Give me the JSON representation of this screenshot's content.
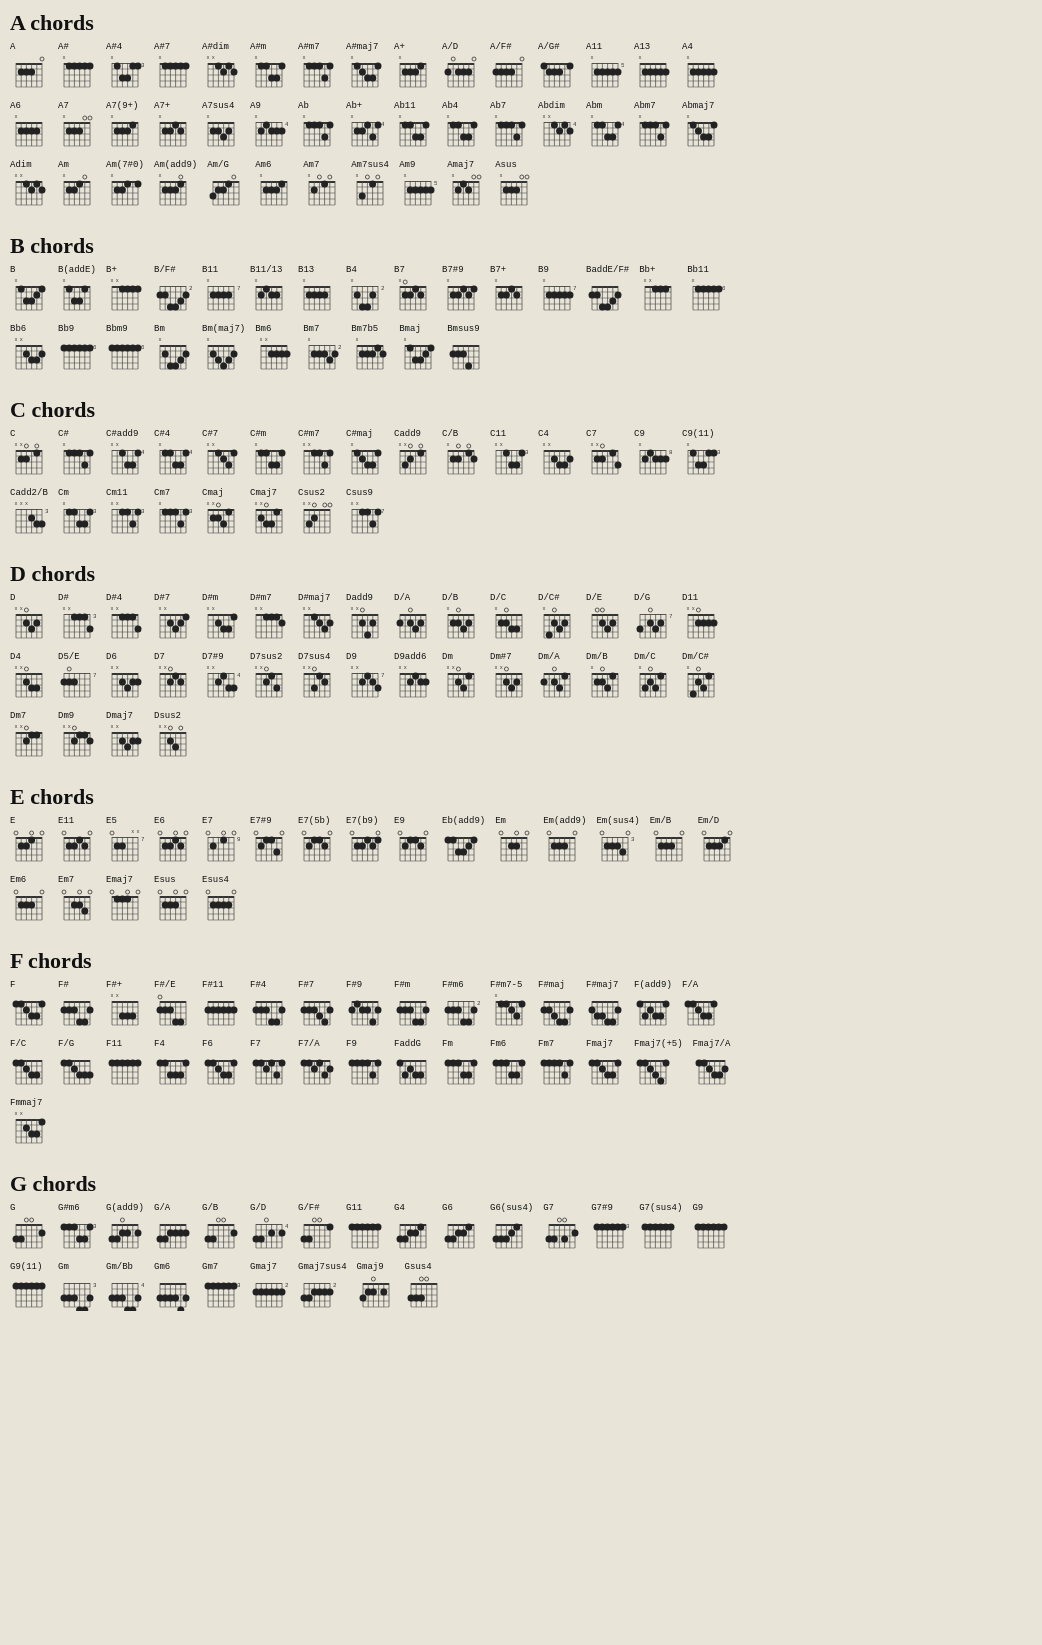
{
  "sections": [
    {
      "id": "A",
      "title": "A chords"
    },
    {
      "id": "B",
      "title": "B chords"
    },
    {
      "id": "C",
      "title": "C chords"
    },
    {
      "id": "D",
      "title": "D chords"
    },
    {
      "id": "E",
      "title": "E chords"
    },
    {
      "id": "F",
      "title": "F chords"
    },
    {
      "id": "G",
      "title": "G chords"
    }
  ]
}
